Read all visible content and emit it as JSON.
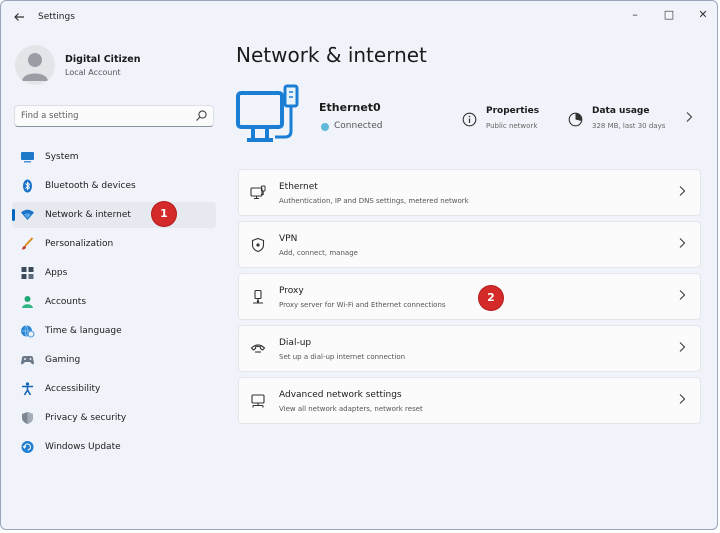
{
  "window": {
    "title": "Settings",
    "controls": {
      "minimize": "–",
      "maximize": "□",
      "close": "✕"
    }
  },
  "profile": {
    "name": "Digital Citizen",
    "account_type": "Local Account"
  },
  "search": {
    "placeholder": "Find a setting"
  },
  "sidebar": {
    "items": [
      {
        "label": "System",
        "icon": "system-icon",
        "active": false
      },
      {
        "label": "Bluetooth & devices",
        "icon": "bluetooth-icon",
        "active": false
      },
      {
        "label": "Network & internet",
        "icon": "wifi-icon",
        "active": true
      },
      {
        "label": "Personalization",
        "icon": "brush-icon",
        "active": false
      },
      {
        "label": "Apps",
        "icon": "apps-icon",
        "active": false
      },
      {
        "label": "Accounts",
        "icon": "accounts-icon",
        "active": false
      },
      {
        "label": "Time & language",
        "icon": "globe-clock-icon",
        "active": false
      },
      {
        "label": "Gaming",
        "icon": "gamepad-icon",
        "active": false
      },
      {
        "label": "Accessibility",
        "icon": "accessibility-icon",
        "active": false
      },
      {
        "label": "Privacy & security",
        "icon": "shield-icon",
        "active": false
      },
      {
        "label": "Windows Update",
        "icon": "update-icon",
        "active": false
      }
    ]
  },
  "main": {
    "title": "Network & internet",
    "connection": {
      "name": "Ethernet0",
      "status": "Connected",
      "status_color": "#5fb9d8"
    },
    "properties": {
      "title": "Properties",
      "subtitle": "Public network"
    },
    "data_usage": {
      "title": "Data usage",
      "subtitle": "328 MB, last 30 days"
    },
    "cards": [
      {
        "title": "Ethernet",
        "subtitle": "Authentication, IP and DNS settings, metered network",
        "icon": "ethernet-icon"
      },
      {
        "title": "VPN",
        "subtitle": "Add, connect, manage",
        "icon": "vpn-shield-icon"
      },
      {
        "title": "Proxy",
        "subtitle": "Proxy server for Wi-Fi and Ethernet connections",
        "icon": "proxy-icon"
      },
      {
        "title": "Dial-up",
        "subtitle": "Set up a dial-up internet connection",
        "icon": "dialup-icon"
      },
      {
        "title": "Advanced network settings",
        "subtitle": "View all network adapters, network reset",
        "icon": "network-monitor-icon"
      }
    ]
  },
  "annotations": {
    "badge_1": "1",
    "badge_2": "2",
    "color": "#d42a2a"
  },
  "colors": {
    "accent": "#0067c0",
    "hero_blue": "#1a7fd4"
  }
}
